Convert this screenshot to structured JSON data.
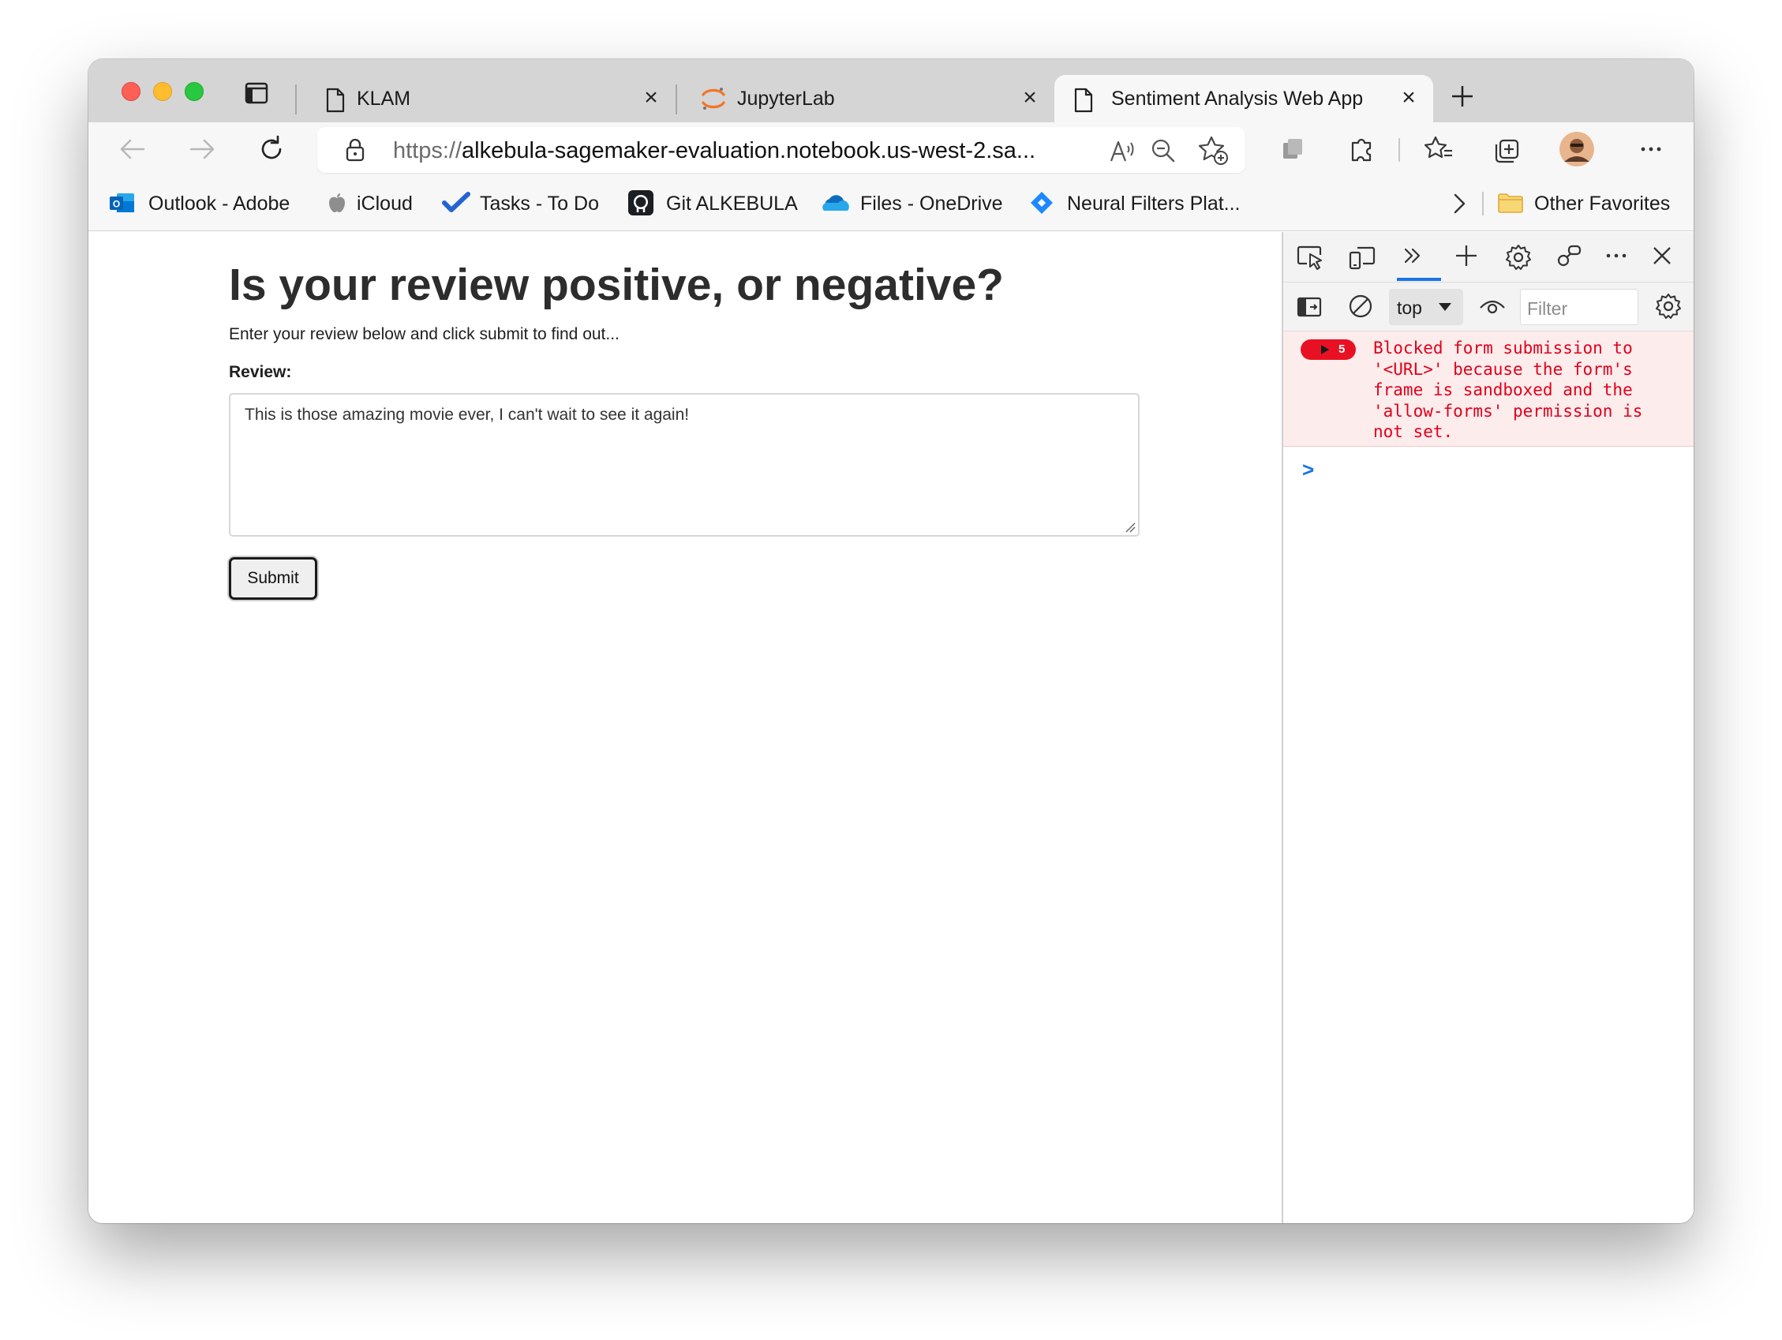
{
  "browser": {
    "tabs": [
      {
        "label": "KLAM",
        "icon": "document-icon",
        "active": false
      },
      {
        "label": "JupyterLab",
        "icon": "jupyter-icon",
        "active": false
      },
      {
        "label": "Sentiment Analysis Web App",
        "icon": "document-icon",
        "active": true
      }
    ],
    "address": {
      "scheme": "https://",
      "host_path": "alkebula-sagemaker-evaluation.notebook.us-west-2.sa..."
    },
    "bookmarks": [
      {
        "label": "Outlook - Adobe",
        "icon": "outlook-icon"
      },
      {
        "label": "iCloud",
        "icon": "apple-icon"
      },
      {
        "label": "Tasks - To Do",
        "icon": "todo-check-icon"
      },
      {
        "label": "Git ALKEBULA",
        "icon": "github-icon"
      },
      {
        "label": "Files - OneDrive",
        "icon": "onedrive-icon"
      },
      {
        "label": "Neural Filters Plat...",
        "icon": "diamond-icon"
      }
    ],
    "other_favorites": "Other Favorites"
  },
  "page": {
    "heading": "Is your review positive, or negative?",
    "intro": "Enter your review below and click submit to find out...",
    "review_label": "Review:",
    "review_value": "This is those amazing movie ever, I can't wait to see it again!",
    "submit_label": "Submit"
  },
  "devtools": {
    "context": "top",
    "filter_placeholder": "Filter",
    "error_count": "5",
    "error_message": "Blocked form submission to\n'<URL>' because the form's\nframe is sandboxed and the\n'allow-forms' permission is\nnot set.",
    "prompt": ">"
  },
  "colors": {
    "error_red": "#e0001b",
    "active_tab_underline": "#1a73e8",
    "jupyter_orange": "#f37626"
  }
}
